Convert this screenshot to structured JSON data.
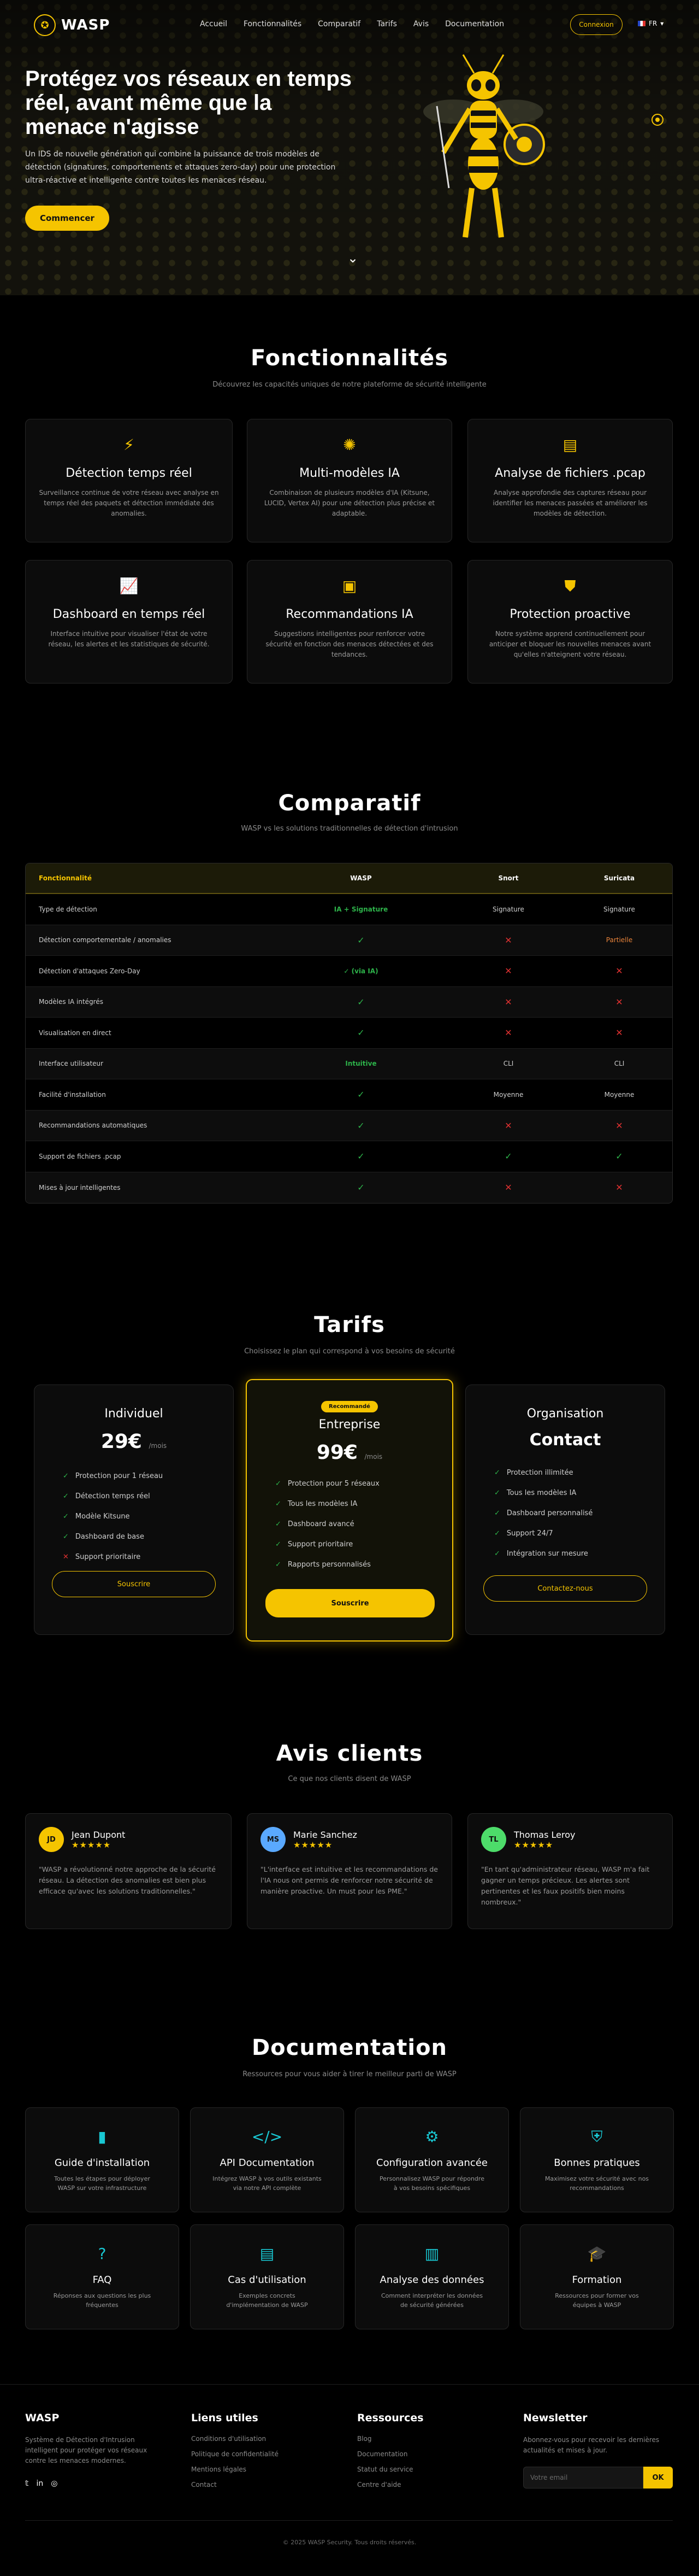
{
  "nav": {
    "brand": "WASP",
    "items": [
      "Accueil",
      "Fonctionnalités",
      "Comparatif",
      "Tarifs",
      "Avis",
      "Documentation"
    ],
    "login": "Connexion",
    "lang": "FR"
  },
  "hero": {
    "title": "Protégez vos réseaux en temps réel, avant même que la menace n'agisse",
    "text": "Un IDS de nouvelle génération qui combine la puissance de trois modèles de détection (signatures, comportements et attaques zero-day) pour une protection ultra-réactive et intelligente contre toutes les menaces réseau.",
    "cta": "Commencer"
  },
  "features": {
    "title": "Fonctionnalités",
    "subtitle": "Découvrez les capacités uniques de notre plateforme de sécurité intelligente",
    "cards": [
      {
        "icon": "lightning-icon",
        "title": "Détection temps réel",
        "text": "Surveillance continue de votre réseau avec analyse en temps réel des paquets et détection immédiate des anomalies."
      },
      {
        "icon": "brain-icon",
        "title": "Multi-modèles IA",
        "text": "Combinaison de plusieurs modèles d'IA (Kitsune, LUCID, Vertex AI) pour une détection plus précise et adaptable."
      },
      {
        "icon": "file-icon",
        "title": "Analyse de fichiers .pcap",
        "text": "Analyse approfondie des captures réseau pour identifier les menaces passées et améliorer les modèles de détection."
      },
      {
        "icon": "chart-icon",
        "title": "Dashboard en temps réel",
        "text": "Interface intuitive pour visualiser l'état de votre réseau, les alertes et les statistiques de sécurité."
      },
      {
        "icon": "robot-icon",
        "title": "Recommandations IA",
        "text": "Suggestions intelligentes pour renforcer votre sécurité en fonction des menaces détectées et des tendances."
      },
      {
        "icon": "shield-icon",
        "title": "Protection proactive",
        "text": "Notre système apprend continuellement pour anticiper et bloquer les nouvelles menaces avant qu'elles n'atteignent votre réseau."
      }
    ]
  },
  "compare": {
    "title": "Comparatif",
    "subtitle": "WASP vs les solutions traditionnelles de détection d'intrusion",
    "headers": [
      "Fonctionnalité",
      "WASP",
      "Snort",
      "Suricata"
    ],
    "rows": [
      [
        "Type de détection",
        "IA + Signature",
        "Signature",
        "Signature"
      ],
      [
        "Détection comportementale / anomalies",
        "✓",
        "✕",
        "Partielle"
      ],
      [
        "Détection d'attaques Zero-Day",
        "✓ (via IA)",
        "✕",
        "✕"
      ],
      [
        "Modèles IA intégrés",
        "✓",
        "✕",
        "✕"
      ],
      [
        "Visualisation en direct",
        "✓",
        "✕",
        "✕"
      ],
      [
        "Interface utilisateur",
        "Intuitive",
        "CLI",
        "CLI"
      ],
      [
        "Facilité d'installation",
        "✓",
        "Moyenne",
        "Moyenne"
      ],
      [
        "Recommandations automatiques",
        "✓",
        "✕",
        "✕"
      ],
      [
        "Support de fichiers .pcap",
        "✓",
        "✓",
        "✓"
      ],
      [
        "Mises à jour intelligentes",
        "✓",
        "✕",
        "✕"
      ]
    ]
  },
  "pricing": {
    "title": "Tarifs",
    "subtitle": "Choisissez le plan qui correspond à vos besoins de sécurité",
    "plans": [
      {
        "name": "Individuel",
        "price": "29€",
        "period": "/mois",
        "features": [
          "Protection pour 1 réseau",
          "Détection temps réel",
          "Modèle Kitsune",
          "Dashboard de base",
          "Support prioritaire"
        ],
        "included": [
          true,
          true,
          true,
          true,
          false
        ],
        "button": "Souscrire"
      },
      {
        "badge": "Recommandé",
        "name": "Entreprise",
        "price": "99€",
        "period": "/mois",
        "features": [
          "Protection pour 5 réseaux",
          "Tous les modèles IA",
          "Dashboard avancé",
          "Support prioritaire",
          "Rapports personnalisés"
        ],
        "button": "Souscrire"
      },
      {
        "name": "Organisation",
        "price": "Contact",
        "features": [
          "Protection illimitée",
          "Tous les modèles IA",
          "Dashboard personnalisé",
          "Support 24/7",
          "Intégration sur mesure"
        ],
        "button": "Contactez-nous"
      }
    ]
  },
  "reviews": {
    "title": "Avis clients",
    "subtitle": "Ce que nos clients disent de WASP",
    "items": [
      {
        "initials": "JD",
        "color": "#f5c400",
        "name": "Jean Dupont",
        "stars": "★★★★★",
        "text": "\"WASP a révolutionné notre approche de la sécurité réseau. La détection des anomalies est bien plus efficace qu'avec les solutions traditionnelles.\""
      },
      {
        "initials": "MS",
        "color": "#5aa9ff",
        "name": "Marie Sanchez",
        "stars": "★★★★★",
        "text": "\"L'interface est intuitive et les recommandations de l'IA nous ont permis de renforcer notre sécurité de manière proactive. Un must pour les PME.\""
      },
      {
        "initials": "TL",
        "color": "#4ddc6a",
        "name": "Thomas Leroy",
        "stars": "★★★★★",
        "text": "\"En tant qu'administrateur réseau, WASP m'a fait gagner un temps précieux. Les alertes sont pertinentes et les faux positifs bien moins nombreux.\""
      }
    ]
  },
  "docs": {
    "title": "Documentation",
    "subtitle": "Ressources pour vous aider à tirer le meilleur parti de WASP",
    "items": [
      {
        "icon": "book-icon",
        "title": "Guide d'installation",
        "text": "Toutes les étapes pour déployer WASP sur votre infrastructure"
      },
      {
        "icon": "code-icon",
        "title": "API Documentation",
        "text": "Intégrez WASP à vos outils existants via notre API complète"
      },
      {
        "icon": "gears-icon",
        "title": "Configuration avancée",
        "text": "Personnalisez WASP pour répondre à vos besoins spécifiques"
      },
      {
        "icon": "shield-check-icon",
        "title": "Bonnes pratiques",
        "text": "Maximisez votre sécurité avec nos recommandations"
      },
      {
        "icon": "question-icon",
        "title": "FAQ",
        "text": "Réponses aux questions les plus fréquentes"
      },
      {
        "icon": "file-alt-icon",
        "title": "Cas d'utilisation",
        "text": "Exemples concrets d'implémentation de WASP"
      },
      {
        "icon": "analytics-icon",
        "title": "Analyse des données",
        "text": "Comment interpréter les données de sécurité générées"
      },
      {
        "icon": "graduation-icon",
        "title": "Formation",
        "text": "Ressources pour former vos équipes à WASP"
      }
    ]
  },
  "footer": {
    "brand": "WASP",
    "brand_text": "Système de Détection d'Intrusion intelligent pour protéger vos réseaux contre les menaces modernes.",
    "links_title": "Liens utiles",
    "links": [
      "Conditions d'utilisation",
      "Politique de confidentialité",
      "Mentions légales",
      "Contact"
    ],
    "res_title": "Ressources",
    "res": [
      "Blog",
      "Documentation",
      "Statut du service",
      "Centre d'aide"
    ],
    "nl_title": "Newsletter",
    "nl_text": "Abonnez-vous pour recevoir les dernières actualités et mises à jour.",
    "nl_placeholder": "Votre email",
    "nl_button": "OK",
    "copyright": "© 2025 WASP Security. Tous droits réservés."
  }
}
